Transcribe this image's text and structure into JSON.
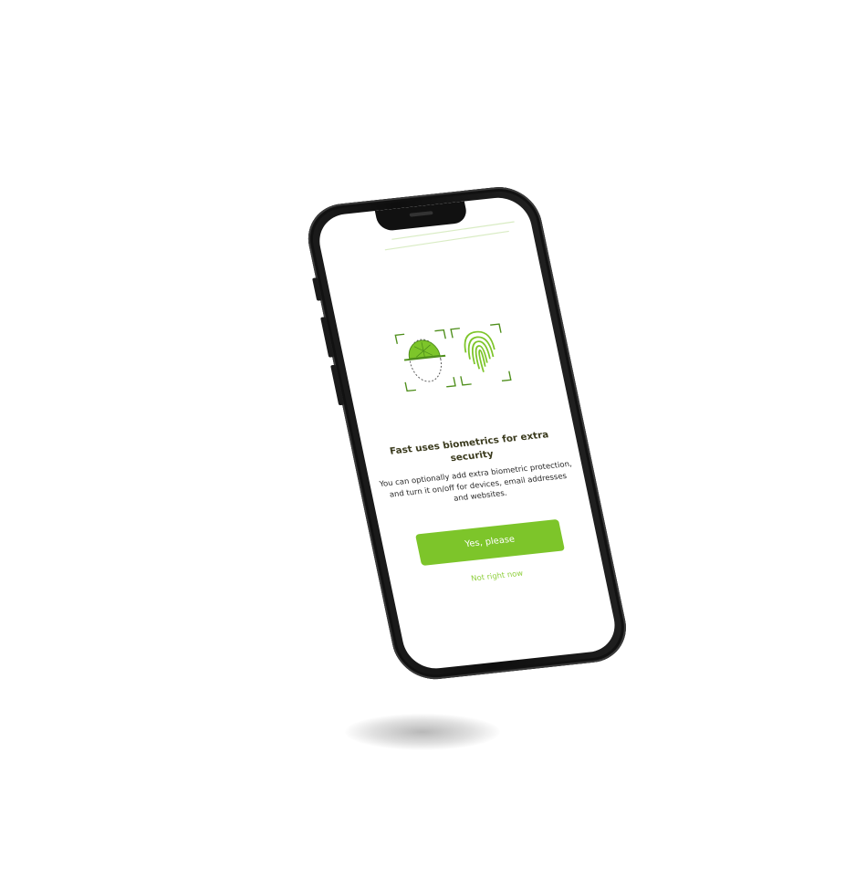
{
  "onboarding": {
    "headline": "Fast uses biometrics for extra security",
    "body": "You can optionally add extra biometric protection, and turn it on/off for devices, email addresses and websites.",
    "primary_button_label": "Yes, please",
    "secondary_link_label": "Not right now"
  },
  "icons": {
    "face": "face-scan-icon",
    "fingerprint": "fingerprint-icon"
  },
  "colors": {
    "accent": "#7dc52a",
    "accent_dark": "#4f8f1c",
    "link": "#8ecf3c",
    "heading": "#3b3b1e"
  }
}
